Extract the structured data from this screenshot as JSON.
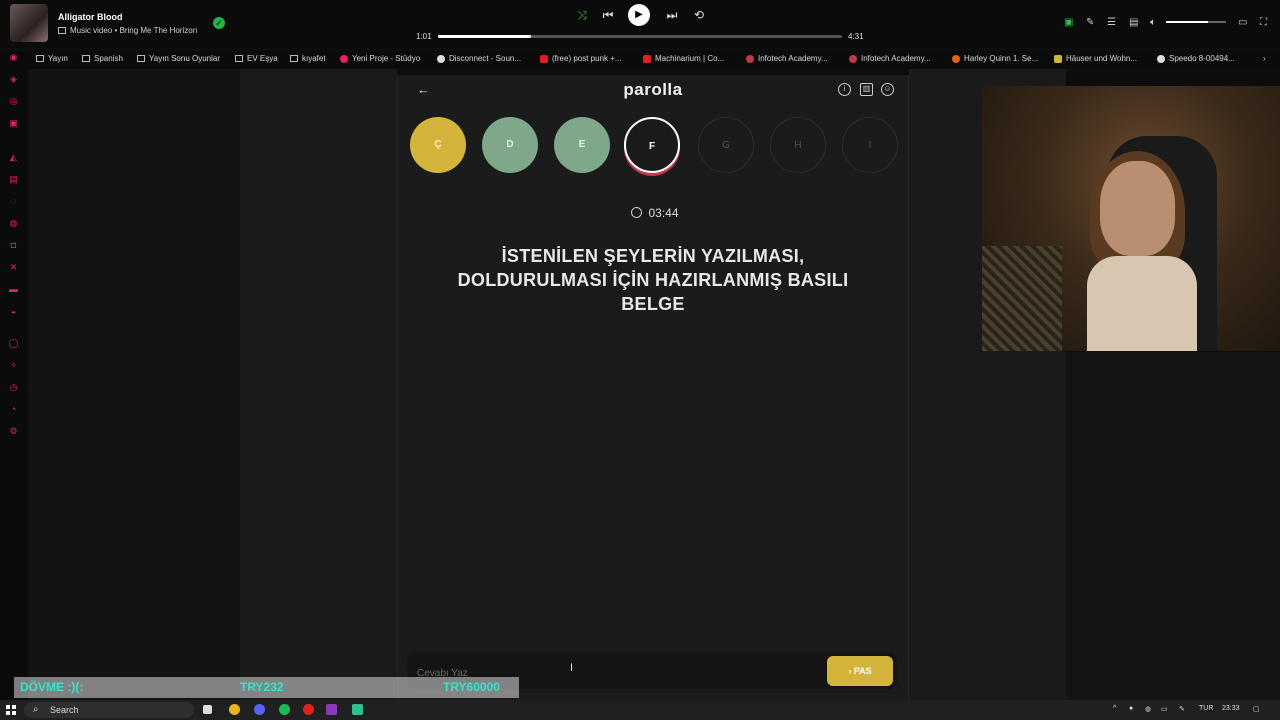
{
  "media": {
    "title": "Alligator Blood",
    "subtitle": "Music video • Bring Me The Horizon",
    "elapsed": "1:01",
    "duration": "4:31",
    "progress_fraction": 0.23,
    "volume_fraction": 0.7
  },
  "bookmarks": [
    {
      "label": "Yayın",
      "type": "folder"
    },
    {
      "label": "Spanish",
      "type": "folder"
    },
    {
      "label": "Yayın Sonu Oyunlar",
      "type": "folder"
    },
    {
      "label": "EV Eşya",
      "type": "folder"
    },
    {
      "label": "kıyafet",
      "type": "folder"
    },
    {
      "label": "Yeni Proje - Stüdyo",
      "type": "site"
    },
    {
      "label": "Disconnect - Soun...",
      "type": "site"
    },
    {
      "label": "(free) post punk +...",
      "type": "site"
    },
    {
      "label": "Machinarium | Co...",
      "type": "site"
    },
    {
      "label": "Infotech Academy...",
      "type": "site"
    },
    {
      "label": "Infotech Academy...",
      "type": "site"
    },
    {
      "label": "Harley Quinn 1. Se...",
      "type": "site"
    },
    {
      "label": "Häuser und Wohn...",
      "type": "site"
    },
    {
      "label": "Speedo 8-00494...",
      "type": "site"
    }
  ],
  "game": {
    "title": "parolla",
    "letters": [
      {
        "letter": "Ç",
        "state": "answered-yellow"
      },
      {
        "letter": "D",
        "state": "answered-green"
      },
      {
        "letter": "E",
        "state": "answered-green"
      },
      {
        "letter": "F",
        "state": "current"
      },
      {
        "letter": "G",
        "state": "future"
      },
      {
        "letter": "H",
        "state": "future"
      },
      {
        "letter": "I",
        "state": "future"
      }
    ],
    "timer": "03:44",
    "question": "İSTENİLEN ŞEYLERİN YAZILMASI, DOLDURULMASI İÇİN HAZIRLANMIŞ BASILI BELGE",
    "answer_placeholder": "Cevabı Yaz",
    "pass_label": "PAS"
  },
  "overlay": {
    "label": "DÖVME :)(:",
    "current": "TRY232",
    "goal": "TRY60000"
  },
  "taskbar": {
    "search_label": "Search",
    "language": "TUR",
    "clock": "23:33"
  },
  "colors": {
    "accent_yellow": "#d4b43a",
    "accent_green": "#7fa88a",
    "current_underline": "#c0394b",
    "overlay_text": "#2ee8d0"
  }
}
